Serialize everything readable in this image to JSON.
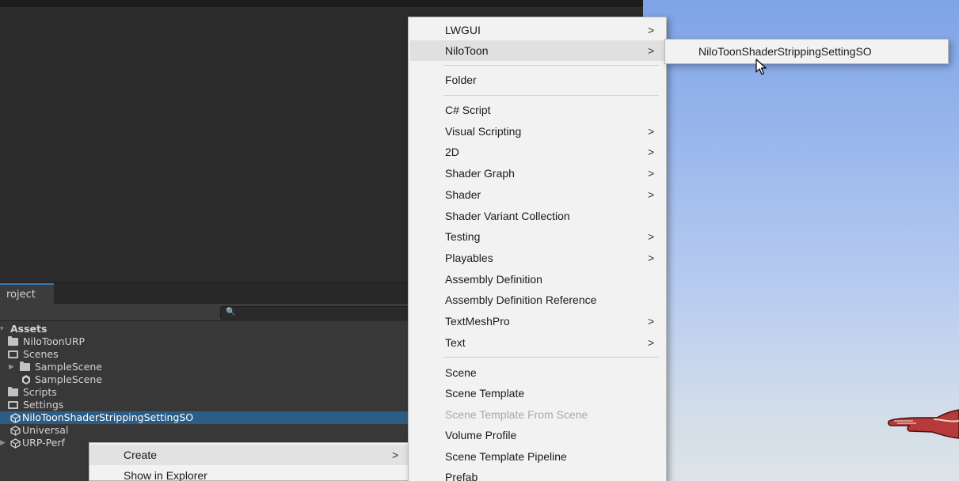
{
  "project_panel": {
    "tab_label": "roject",
    "search_placeholder": "",
    "tree": [
      {
        "label": "Assets",
        "icon": "arrow-down"
      },
      {
        "label": "NiloToonURP",
        "icon": "folder-icon"
      },
      {
        "label": "Scenes",
        "icon": "folder-open-icon"
      },
      {
        "label": "SampleScene",
        "icon": "folder-icon"
      },
      {
        "label": "SampleScene",
        "icon": "unity-scene-icon"
      },
      {
        "label": "Scripts",
        "icon": "folder-icon"
      },
      {
        "label": "Settings",
        "icon": "folder-open-icon"
      },
      {
        "label": "NiloToonShaderStrippingSettingSO",
        "icon": "scriptable-object-icon",
        "selected": true
      },
      {
        "label": "Universal",
        "icon": "scriptable-object-icon"
      },
      {
        "label": "URP-Perf",
        "icon": "scriptable-object-icon"
      }
    ]
  },
  "context_menu": {
    "items": [
      {
        "label": "Create",
        "submenu": true,
        "highlighted": true
      },
      {
        "label": "Show in Explorer"
      }
    ]
  },
  "create_menu": {
    "items": [
      {
        "label": "LWGUI",
        "submenu": true
      },
      {
        "label": "NiloToon",
        "submenu": true,
        "highlighted": true
      },
      {
        "label": "Folder"
      },
      {
        "label": "C# Script"
      },
      {
        "label": "Visual Scripting",
        "submenu": true
      },
      {
        "label": "2D",
        "submenu": true
      },
      {
        "label": "Shader Graph",
        "submenu": true
      },
      {
        "label": "Shader",
        "submenu": true
      },
      {
        "label": "Shader Variant Collection"
      },
      {
        "label": "Testing",
        "submenu": true
      },
      {
        "label": "Playables",
        "submenu": true
      },
      {
        "label": "Assembly Definition"
      },
      {
        "label": "Assembly Definition Reference"
      },
      {
        "label": "TextMeshPro",
        "submenu": true
      },
      {
        "label": "Text",
        "submenu": true
      },
      {
        "label": "Scene"
      },
      {
        "label": "Scene Template"
      },
      {
        "label": "Scene Template From Scene",
        "disabled": true
      },
      {
        "label": "Volume Profile"
      },
      {
        "label": "Scene Template Pipeline"
      },
      {
        "label": "Prefab"
      }
    ]
  },
  "submenu": {
    "items": [
      {
        "label": "NiloToonShaderStrippingSettingSO"
      }
    ]
  },
  "chevron": ">",
  "colors": {
    "selection": "#2c5d87",
    "menu_bg": "#f2f2f2",
    "menu_highlight": "#e0e0e0",
    "tab_accent": "#3a79bb"
  }
}
